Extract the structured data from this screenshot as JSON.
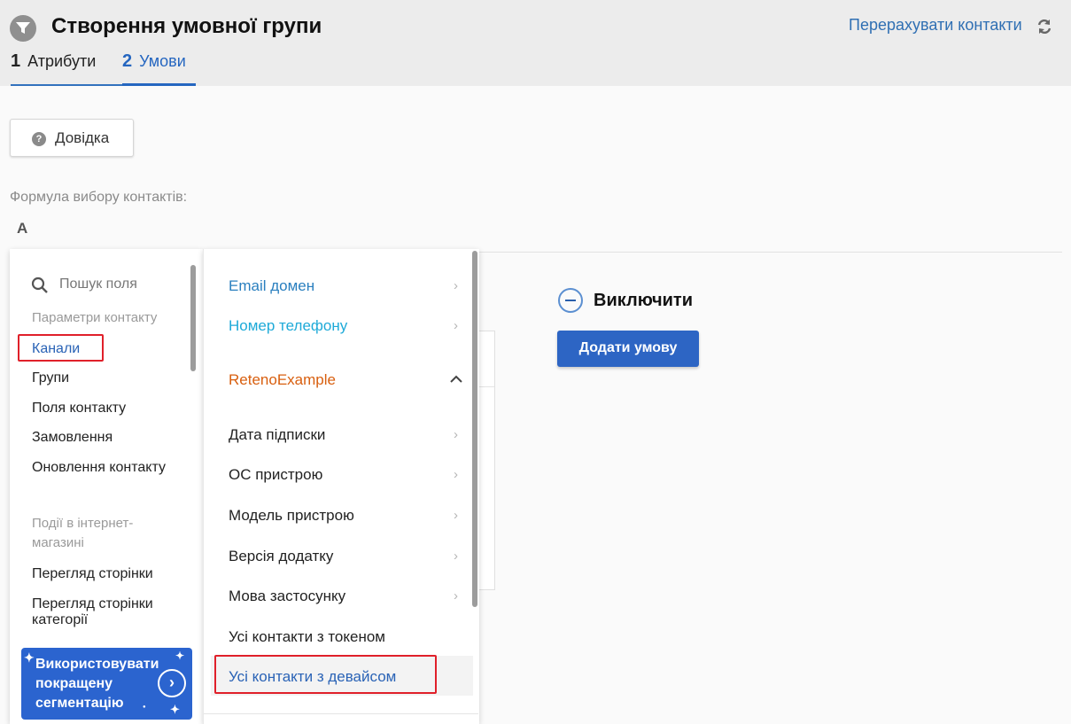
{
  "header": {
    "title": "Створення умовної групи",
    "recalc_link": "Перерахувати контакти",
    "steps": [
      {
        "num": "1",
        "label": "Атрибути"
      },
      {
        "num": "2",
        "label": "Умови"
      }
    ]
  },
  "help_button": {
    "label": "Довідка"
  },
  "formula": {
    "label": "Формула вибору контактів:",
    "value": "A"
  },
  "left_menu": {
    "search_placeholder": "Пошук поля",
    "section_contact": "Параметри контакту",
    "contact_items": [
      "Канали",
      "Групи",
      "Поля контакту",
      "Замовлення",
      "Оновлення контакту"
    ],
    "section_shop": "Події в інтернет-магазині",
    "shop_items": [
      "Перегляд сторінки",
      "Перегляд сторінки категорії"
    ],
    "promo_text": "Використовувати покращену сегментацію"
  },
  "right_menu": {
    "items": [
      "Email домен",
      "Номер телефону",
      "RetenoExample",
      "Дата підписки",
      "ОС пристрою",
      "Модель пристрою",
      "Версія додатку",
      "Мова застосунку",
      "Усі контакти з токеном",
      "Усі контакти з девайсом"
    ]
  },
  "exclude": {
    "label": "Виключити",
    "add_button": "Додати умову"
  },
  "colors": {
    "accent": "#2d65c4",
    "highlight": "#e0202a",
    "brand_orange": "#d85f0f"
  }
}
